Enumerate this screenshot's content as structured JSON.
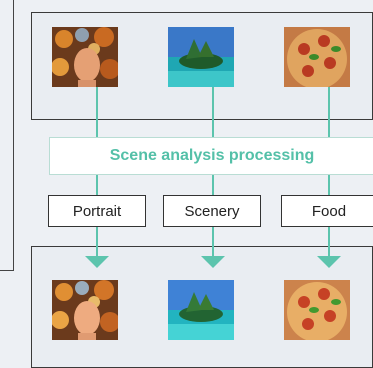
{
  "banner": {
    "text": "Scene analysis processing"
  },
  "categories": [
    {
      "label": "Portrait",
      "thumb_icon": "portrait-icon"
    },
    {
      "label": "Scenery",
      "thumb_icon": "scenery-icon"
    },
    {
      "label": "Food",
      "thumb_icon": "food-icon"
    }
  ],
  "colors": {
    "accent": "#5cc4ad",
    "banner_text": "#54c0a8",
    "background": "#edf0f4"
  }
}
